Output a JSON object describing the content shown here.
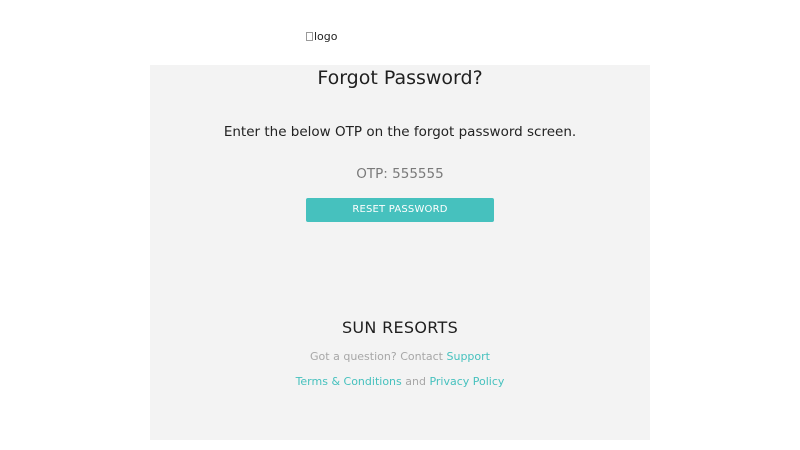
{
  "logo": {
    "alt_text": "logo"
  },
  "header": {
    "title": "Forgot Password?"
  },
  "message": {
    "instructions": "Enter the below OTP on the forgot password screen.",
    "otp_label": "OTP: 555555"
  },
  "actions": {
    "reset_label": "RESET PASSWORD"
  },
  "footer": {
    "brand": "SUN RESORTS",
    "question_text": "Got a question? Contact ",
    "support_link": "Support",
    "terms_link": "Terms & Conditions",
    "and_text": " and ",
    "privacy_link": "Privacy Policy"
  },
  "colors": {
    "accent": "#46c1be",
    "card_background": "#f3f3f3",
    "muted_text": "#a7a7a7"
  }
}
